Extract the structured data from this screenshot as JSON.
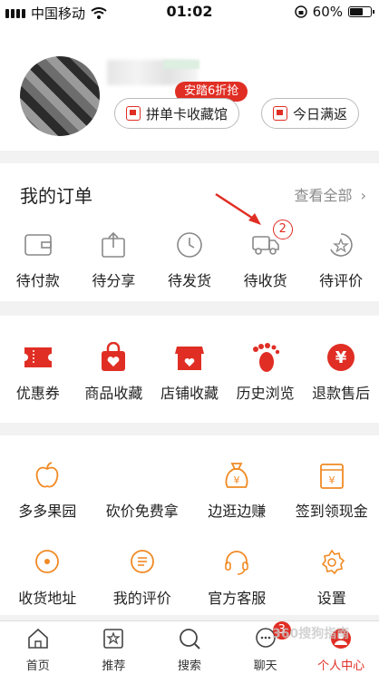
{
  "status": {
    "carrier": "中国移动",
    "time": "01:02",
    "battery": "60%"
  },
  "profile": {
    "promo_tag": "安踏6折抢",
    "pill1": "拼单卡收藏馆",
    "pill2": "今日满返"
  },
  "orders": {
    "title": "我的订单",
    "view_all": "查看全部",
    "items": [
      {
        "label": "待付款",
        "icon": "wallet-icon"
      },
      {
        "label": "待分享",
        "icon": "share-icon"
      },
      {
        "label": "待发货",
        "icon": "clock-icon"
      },
      {
        "label": "待收货",
        "icon": "truck-icon",
        "badge": "2"
      },
      {
        "label": "待评价",
        "icon": "review-icon"
      }
    ]
  },
  "shortcuts": [
    {
      "label": "优惠券",
      "icon": "coupon-icon"
    },
    {
      "label": "商品收藏",
      "icon": "bag-heart-icon"
    },
    {
      "label": "店铺收藏",
      "icon": "store-heart-icon"
    },
    {
      "label": "历史浏览",
      "icon": "footprint-icon"
    },
    {
      "label": "退款售后",
      "icon": "yen-icon"
    }
  ],
  "services_row1": [
    {
      "label": "多多果园",
      "icon": "apple-icon"
    },
    {
      "label": "砍价免费拿",
      "icon": ""
    },
    {
      "label": "边逛边赚",
      "icon": "money-bag-icon"
    },
    {
      "label": "签到领现金",
      "icon": "calendar-yen-icon"
    }
  ],
  "services_row2": [
    {
      "label": "收货地址",
      "icon": "location-icon"
    },
    {
      "label": "我的评价",
      "icon": "comment-icon"
    },
    {
      "label": "官方客服",
      "icon": "headset-icon"
    },
    {
      "label": "设置",
      "icon": "settings-icon"
    }
  ],
  "tabbar": {
    "tabs": [
      {
        "label": "首页",
        "icon": "home-icon"
      },
      {
        "label": "推荐",
        "icon": "star-bag-icon"
      },
      {
        "label": "搜索",
        "icon": "search-icon"
      },
      {
        "label": "聊天",
        "icon": "chat-icon",
        "badge": "3"
      },
      {
        "label": "个人中心",
        "icon": "profile-icon",
        "active": true
      }
    ]
  },
  "watermark": "360搜狗指南",
  "colors": {
    "accent": "#e02e24",
    "orange": "#f08a24"
  }
}
